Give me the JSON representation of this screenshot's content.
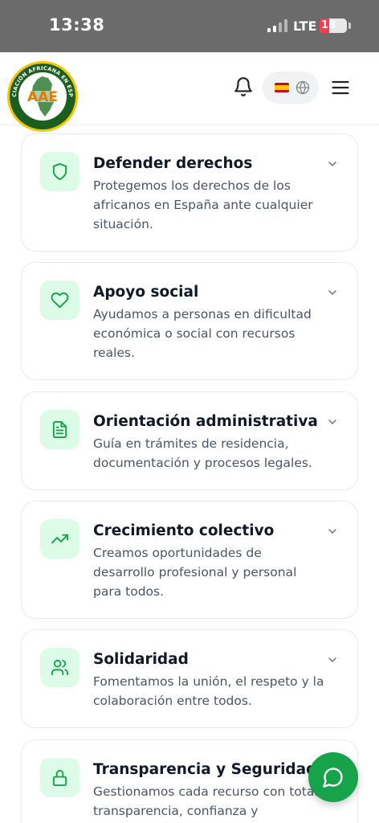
{
  "status_bar": {
    "time": "13:38",
    "network": "LTE",
    "battery": "18",
    "battery_level": 0.18,
    "signal_icon": "cellular-signal-icon"
  },
  "header": {
    "logo_text": "AAE",
    "logo_ring_text": "ASOCIACIÓN AFRICANA EN ESPAÑA",
    "bell_icon": "bell-icon",
    "language_flag": "spain-flag-icon",
    "globe_icon": "globe-icon",
    "menu_icon": "hamburger-menu-icon"
  },
  "colors": {
    "accent": "#16a34a",
    "icon_tile_bg": "#dcfce7",
    "title_text": "#111827",
    "body_text": "#4b5563"
  },
  "cards": [
    {
      "title": "Defender derechos",
      "icon": "shield-icon",
      "desc": [
        "Protegemos los derechos de los",
        "africanos en España ante cualquier",
        "situación."
      ]
    },
    {
      "title": "Apoyo social",
      "icon": "heart-icon",
      "desc": [
        "Ayudamos a personas en dificultad",
        "económica o social con recursos",
        "reales."
      ]
    },
    {
      "title": "Orientación administrativa",
      "icon": "document-icon",
      "desc": [
        "Guía en trámites de residencia,",
        "documentación y procesos legales."
      ]
    },
    {
      "title": "Crecimiento colectivo",
      "icon": "trending-up-icon",
      "desc": [
        "Creamos oportunidades de",
        "desarrollo profesional y personal",
        "para todos."
      ]
    },
    {
      "title": "Solidaridad",
      "icon": "users-icon",
      "desc": [
        "Fomentamos la unión, el respeto y la",
        "colaboración entre todos."
      ]
    },
    {
      "title": "Transparencia y Seguridad",
      "icon": "lock-icon",
      "desc": [
        "Gestionamos cada recurso con total",
        "transparencia, confianza y"
      ]
    }
  ],
  "chat_button": {
    "icon": "chat-bubble-icon"
  }
}
